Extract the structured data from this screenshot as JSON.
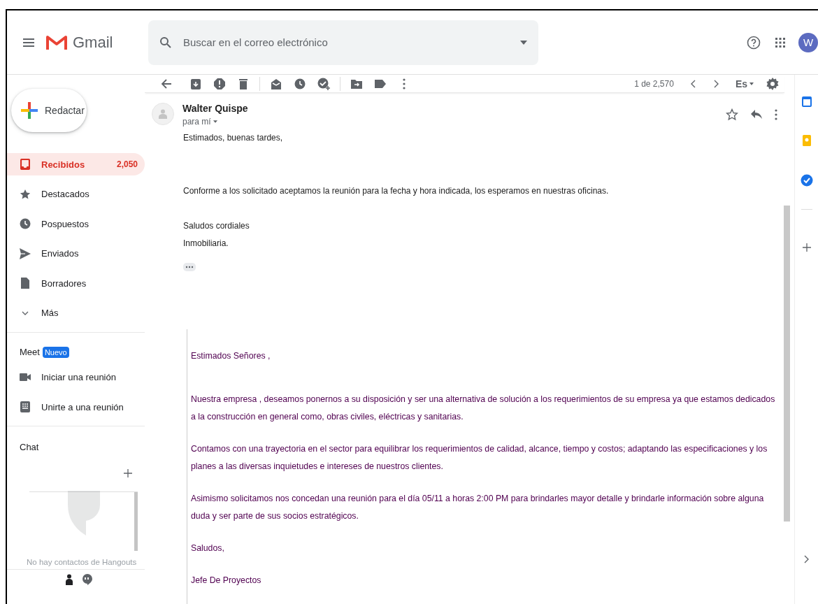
{
  "header": {
    "product": "Gmail",
    "search": {
      "placeholder": "Buscar en el correo electrónico"
    },
    "avatar": "W"
  },
  "sidebar": {
    "compose": "Redactar",
    "items": [
      {
        "label": "Recibidos",
        "count": "2,050",
        "selected": true
      },
      {
        "label": "Destacados",
        "selected": false
      },
      {
        "label": "Pospuestos",
        "selected": false
      },
      {
        "label": "Enviados",
        "selected": false
      },
      {
        "label": "Borradores",
        "selected": false
      },
      {
        "label": "Más",
        "selected": false
      }
    ],
    "meet": {
      "title": "Meet",
      "badge": "Nuevo",
      "items": [
        "Iniciar una reunión",
        "Unirte a una reunión"
      ]
    },
    "chat": {
      "title": "Chat",
      "empty_text": "No hay contactos de Hangouts"
    }
  },
  "toolbar": {
    "pager": "1 de 2,570",
    "language": "Es"
  },
  "message": {
    "sender": "Walter Quispe",
    "recipient": "para mí",
    "body": [
      "Estimados, buenas tardes,",
      "Conforme a los solicitado aceptamos la reunión para la fecha y hora indicada, los esperamos en nuestras oficinas.",
      "Saludos cordiales\nInmobiliaria."
    ],
    "quoted": [
      "Estimados Señores ,",
      "Nuestra empresa            , deseamos ponernos a su disposición y ser una alternativa de solución a los requerimientos de su empresa ya que estamos dedicados a la construcción en general como, obras civiles, eléctricas y sanitarias.",
      "Contamos con una trayectoria en el sector para equilibrar los requerimientos de calidad, alcance, tiempo y costos; adaptando las especificaciones y los planes a las diversas inquietudes e intereses de nuestros clientes.",
      "Asimismo solicitamos nos concedan una reunión para el día 05/11 a horas 2:00 PM para brindarles mayor detalle y brindarle información sobre alguna duda y ser parte de sus socios estratégicos.",
      "Saludos,",
      "Jefe De Proyectos"
    ]
  }
}
